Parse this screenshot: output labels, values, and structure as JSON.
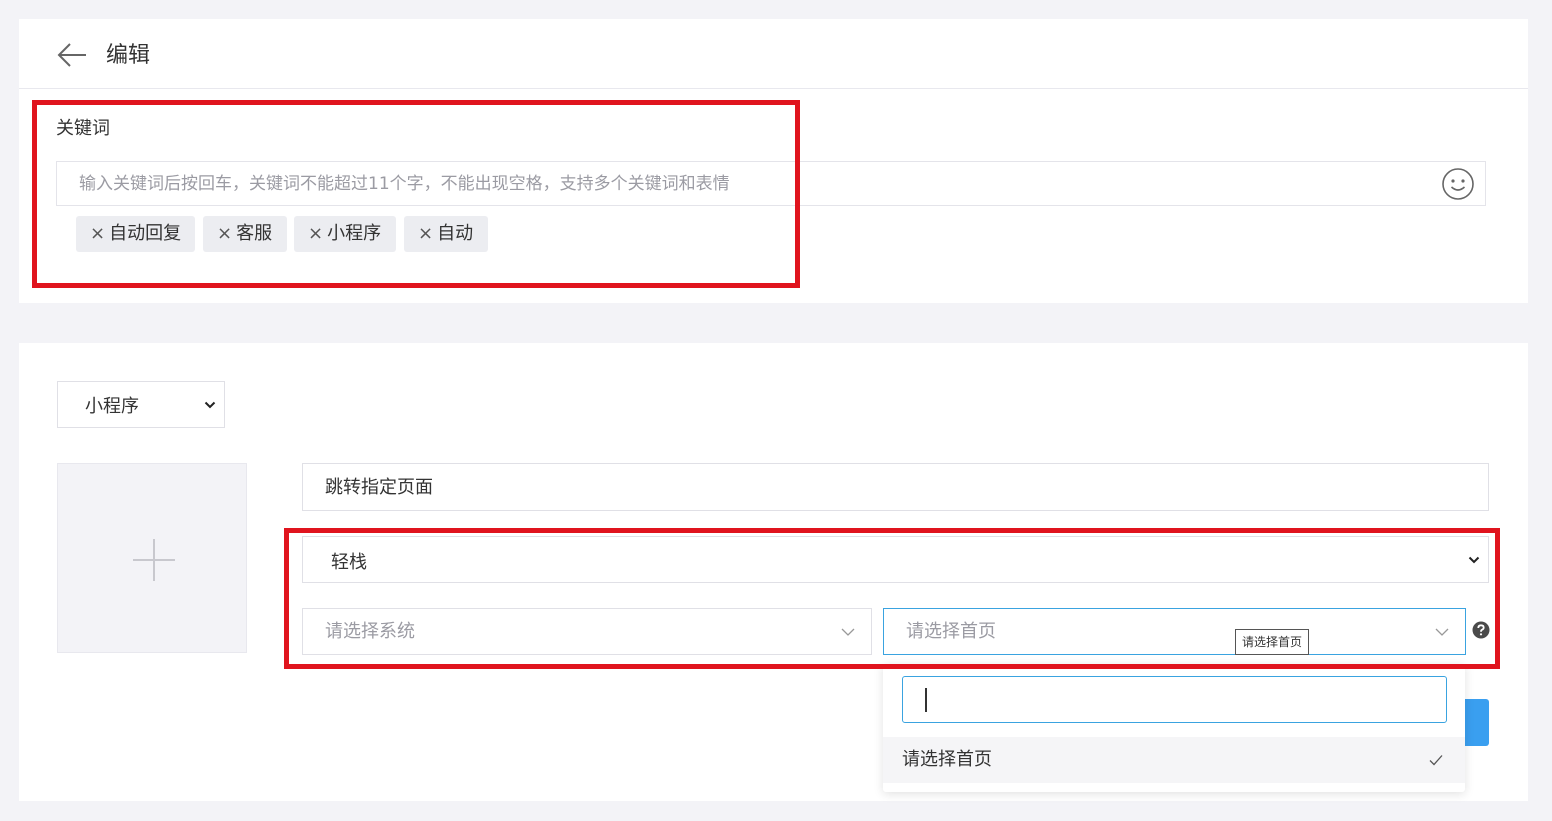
{
  "header": {
    "title": "编辑"
  },
  "keywords": {
    "label": "关键词",
    "placeholder": "输入关键词后按回车，关键词不能超过11个字，不能出现空格，支持多个关键词和表情",
    "remove_symbol": "×",
    "tags": [
      "自动回复",
      "客服",
      "小程序",
      "自动"
    ]
  },
  "reply": {
    "type_select": "小程序",
    "page_input_value": "跳转指定页面",
    "app_select": "轻栈",
    "system_select_placeholder": "请选择系统",
    "home_select_placeholder": "请选择首页",
    "tooltip": "请选择首页",
    "dropdown": {
      "search_value": "",
      "options": [
        "请选择首页"
      ]
    }
  },
  "colors": {
    "highlight_border": "#e0141e",
    "focus_border": "#3aa3e0",
    "primary_button": "#3a9ff0",
    "page_background": "#f3f3f7"
  },
  "icons": [
    "back-arrow-icon",
    "emoji-icon",
    "plus-icon",
    "chevron-down-icon",
    "help-icon",
    "check-icon"
  ]
}
